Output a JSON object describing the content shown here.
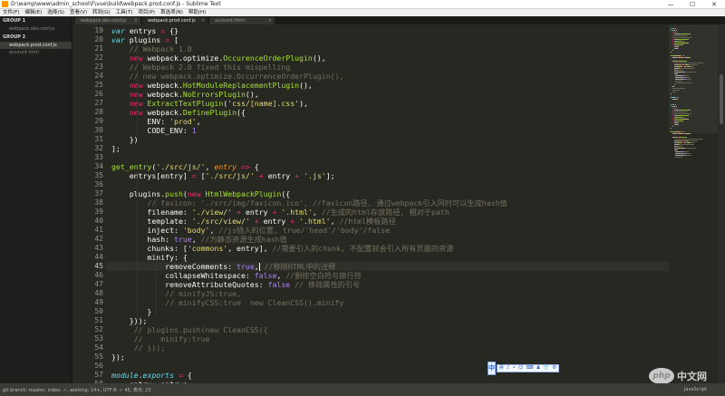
{
  "window": {
    "title": "D:\\wamp\\www\\admin_school\\F\\vue\\build\\webpack.prod.conf.js - Sublime Text",
    "icon": "sublime-text-icon",
    "minimize": "—",
    "maximize": "☐",
    "close": "✕"
  },
  "menu": [
    "文件(F)",
    "编辑(E)",
    "选择(S)",
    "查看(V)",
    "转到(G)",
    "工具(T)",
    "项目(P)",
    "首选项(N)",
    "帮助(H)"
  ],
  "sidebar": {
    "group1": "GROUP 1",
    "group2": "GROUP 2",
    "files": [
      "webpack.dev.conf.js",
      "webpack.prod.conf.js",
      "account.html"
    ]
  },
  "tabs": [
    {
      "label": "webpack.dev.conf.js",
      "close": "×"
    },
    {
      "label": "webpack.prod.conf.js",
      "close": "×"
    },
    {
      "label": "account.html",
      "close": "×"
    }
  ],
  "editor": {
    "current_line": 45,
    "lines": [
      {
        "n": "19",
        "tokens": [
          [
            "kw",
            "var"
          ],
          [
            "pl",
            " entrys "
          ],
          [
            "op",
            "="
          ],
          [
            "pl",
            " {}"
          ]
        ]
      },
      {
        "n": "20",
        "tokens": [
          [
            "kw",
            "var"
          ],
          [
            "pl",
            " plugins "
          ],
          [
            "op",
            "="
          ],
          [
            "pl",
            " ["
          ]
        ]
      },
      {
        "n": "21",
        "tokens": [
          [
            "pl",
            "    "
          ],
          [
            "cm",
            "// Webpack 1.0"
          ]
        ]
      },
      {
        "n": "22",
        "tokens": [
          [
            "pl",
            "    "
          ],
          [
            "kn",
            "new"
          ],
          [
            "pl",
            " webpack.optimize."
          ],
          [
            "fn",
            "OccurenceOrderPlugin"
          ],
          [
            "pl",
            "(),"
          ]
        ]
      },
      {
        "n": "23",
        "tokens": [
          [
            "pl",
            "    "
          ],
          [
            "cm",
            "// Webpack 2.0 fixed this mispelling"
          ]
        ]
      },
      {
        "n": "24",
        "tokens": [
          [
            "pl",
            "    "
          ],
          [
            "cm",
            "// new webpack.optimize.OccurrenceOrderPlugin(),"
          ]
        ]
      },
      {
        "n": "25",
        "tokens": [
          [
            "pl",
            "    "
          ],
          [
            "kn",
            "new"
          ],
          [
            "pl",
            " webpack."
          ],
          [
            "fn",
            "HotModuleReplacementPlugin"
          ],
          [
            "pl",
            "(),"
          ]
        ]
      },
      {
        "n": "26",
        "tokens": [
          [
            "pl",
            "    "
          ],
          [
            "kn",
            "new"
          ],
          [
            "pl",
            " webpack."
          ],
          [
            "fn",
            "NoErrorsPlugin"
          ],
          [
            "pl",
            "(),"
          ]
        ]
      },
      {
        "n": "27",
        "tokens": [
          [
            "pl",
            "    "
          ],
          [
            "kn",
            "new"
          ],
          [
            "pl",
            " "
          ],
          [
            "fn",
            "ExtractTextPlugin"
          ],
          [
            "pl",
            "("
          ],
          [
            "st",
            "'css/[name].css'"
          ],
          [
            "pl",
            "),"
          ]
        ]
      },
      {
        "n": "28",
        "tokens": [
          [
            "pl",
            "    "
          ],
          [
            "kn",
            "new"
          ],
          [
            "pl",
            " webpack."
          ],
          [
            "fn",
            "DefinePlugin"
          ],
          [
            "pl",
            "({"
          ]
        ]
      },
      {
        "n": "29",
        "tokens": [
          [
            "pl",
            "        ENV: "
          ],
          [
            "st",
            "'prod'"
          ],
          [
            "pl",
            ","
          ]
        ]
      },
      {
        "n": "30",
        "tokens": [
          [
            "pl",
            "        CODE_ENV: "
          ],
          [
            "nu",
            "1"
          ]
        ]
      },
      {
        "n": "31",
        "tokens": [
          [
            "pl",
            "    })"
          ]
        ]
      },
      {
        "n": "32",
        "tokens": [
          [
            "pl",
            "];"
          ]
        ]
      },
      {
        "n": "33",
        "tokens": []
      },
      {
        "n": "34",
        "tokens": [
          [
            "fn",
            "get_entry"
          ],
          [
            "pl",
            "("
          ],
          [
            "st",
            "'./src/js/'"
          ],
          [
            "pl",
            ", "
          ],
          [
            "pa",
            "entry"
          ],
          [
            "pl",
            " "
          ],
          [
            "op",
            "=>"
          ],
          [
            "pl",
            " {"
          ]
        ]
      },
      {
        "n": "35",
        "tokens": [
          [
            "pl",
            "    entrys[entry] "
          ],
          [
            "op",
            "="
          ],
          [
            "pl",
            " ["
          ],
          [
            "st",
            "'./src/js/'"
          ],
          [
            "pl",
            " "
          ],
          [
            "op",
            "+"
          ],
          [
            "pl",
            " entry "
          ],
          [
            "op",
            "+"
          ],
          [
            "pl",
            " "
          ],
          [
            "st",
            "'.js'"
          ],
          [
            "pl",
            "];"
          ]
        ]
      },
      {
        "n": "36",
        "tokens": []
      },
      {
        "n": "37",
        "tokens": [
          [
            "pl",
            "    plugins."
          ],
          [
            "fn",
            "push"
          ],
          [
            "pl",
            "("
          ],
          [
            "kn",
            "new"
          ],
          [
            "pl",
            " "
          ],
          [
            "fn",
            "HtmlWebpackPlugin"
          ],
          [
            "pl",
            "({"
          ]
        ]
      },
      {
        "n": "38",
        "tokens": [
          [
            "pl",
            "        "
          ],
          [
            "cm",
            "// favicon: './src/img/favicon.ico', //favicon路径, 通过webpack引入同时可以生成hash值"
          ]
        ]
      },
      {
        "n": "39",
        "tokens": [
          [
            "pl",
            "        filename: "
          ],
          [
            "st",
            "'./view/'"
          ],
          [
            "pl",
            " "
          ],
          [
            "op",
            "+"
          ],
          [
            "pl",
            " entry "
          ],
          [
            "op",
            "+"
          ],
          [
            "pl",
            " "
          ],
          [
            "st",
            "'.html'"
          ],
          [
            "pl",
            ", "
          ],
          [
            "cm",
            "//生成的html存放路径, 相对于path"
          ]
        ]
      },
      {
        "n": "40",
        "tokens": [
          [
            "pl",
            "        template: "
          ],
          [
            "st",
            "'./src/view/'"
          ],
          [
            "pl",
            " "
          ],
          [
            "op",
            "+"
          ],
          [
            "pl",
            " entry "
          ],
          [
            "op",
            "+"
          ],
          [
            "pl",
            " "
          ],
          [
            "st",
            "'.html'"
          ],
          [
            "pl",
            ", "
          ],
          [
            "cm",
            "//html模板路径"
          ]
        ]
      },
      {
        "n": "41",
        "tokens": [
          [
            "pl",
            "        inject: "
          ],
          [
            "st",
            "'body'"
          ],
          [
            "pl",
            ", "
          ],
          [
            "cm",
            "//js插入的位置, true/'head'/'body'/false"
          ]
        ]
      },
      {
        "n": "42",
        "tokens": [
          [
            "pl",
            "        hash: "
          ],
          [
            "nu",
            "true"
          ],
          [
            "pl",
            ", "
          ],
          [
            "cm",
            "//为静态资源生成hash值"
          ]
        ]
      },
      {
        "n": "43",
        "tokens": [
          [
            "pl",
            "        chunks: ["
          ],
          [
            "st",
            "'commons'"
          ],
          [
            "pl",
            ", entry], "
          ],
          [
            "cm",
            "//需要引入的chunk, 不配置就会引入所有页面的资源"
          ]
        ]
      },
      {
        "n": "44",
        "tokens": [
          [
            "pl",
            "        minify: {"
          ]
        ]
      },
      {
        "n": "45",
        "tokens": [
          [
            "pl",
            "            removeComments: "
          ],
          [
            "nu",
            "true"
          ],
          [
            "pl",
            ","
          ],
          [
            "caret",
            ""
          ],
          [
            "pl",
            " "
          ],
          [
            "cm",
            "//移除HTML中的注释"
          ]
        ]
      },
      {
        "n": "46",
        "tokens": [
          [
            "pl",
            "            collapseWhitespace: "
          ],
          [
            "nu",
            "false"
          ],
          [
            "pl",
            ", "
          ],
          [
            "cm",
            "//删除空白符与换行符"
          ]
        ]
      },
      {
        "n": "47",
        "tokens": [
          [
            "pl",
            "            removeAttributeQuotes: "
          ],
          [
            "nu",
            "false"
          ],
          [
            "pl",
            " "
          ],
          [
            "cm",
            "// 移除属性的引号"
          ]
        ]
      },
      {
        "n": "48",
        "tokens": [
          [
            "pl",
            "            "
          ],
          [
            "cm",
            "// minifyJS:true,"
          ]
        ]
      },
      {
        "n": "49",
        "tokens": [
          [
            "pl",
            "            "
          ],
          [
            "cm",
            "// minifyCSS:true  new CleanCSS().minify"
          ]
        ]
      },
      {
        "n": "50",
        "tokens": [
          [
            "pl",
            "        }"
          ]
        ]
      },
      {
        "n": "51",
        "tokens": [
          [
            "pl",
            "    }));"
          ]
        ]
      },
      {
        "n": "52",
        "tokens": [
          [
            "pl",
            "     "
          ],
          [
            "cm",
            "// plugins.push(new CleanCSS({"
          ]
        ]
      },
      {
        "n": "53",
        "tokens": [
          [
            "pl",
            "     "
          ],
          [
            "cm",
            "//    minify:true"
          ]
        ]
      },
      {
        "n": "54",
        "tokens": [
          [
            "pl",
            "     "
          ],
          [
            "cm",
            "// }));"
          ]
        ]
      },
      {
        "n": "55",
        "tokens": [
          [
            "pl",
            "});"
          ]
        ]
      },
      {
        "n": "56",
        "tokens": []
      },
      {
        "n": "57",
        "tokens": [
          [
            "kw",
            "module"
          ],
          [
            "pl",
            "."
          ],
          [
            "kw",
            "exports"
          ],
          [
            "pl",
            " "
          ],
          [
            "op",
            "="
          ],
          [
            "pl",
            " {"
          ]
        ]
      },
      {
        "n": "58",
        "tokens": [
          [
            "pl",
            "    entry: entrys,"
          ]
        ]
      }
    ]
  },
  "ime": {
    "logo": "中",
    "tools": [
      "英",
      "♪",
      "•",
      "☺",
      "⌨",
      "♟",
      "👕",
      "⚙"
    ]
  },
  "watermark": {
    "logo": "php",
    "text": "中文网"
  },
  "status": {
    "left": "git branch: master, index: ✓, working: 14+, UTF-8: ✓ 45, 表示: 23",
    "right": "JavaScript"
  },
  "colors": {
    "background": "#272822",
    "keyword": "#66d9ef",
    "storage": "#f92672",
    "function": "#a6e22e",
    "string": "#e6db74",
    "number": "#ae81ff",
    "comment": "#75715e"
  }
}
